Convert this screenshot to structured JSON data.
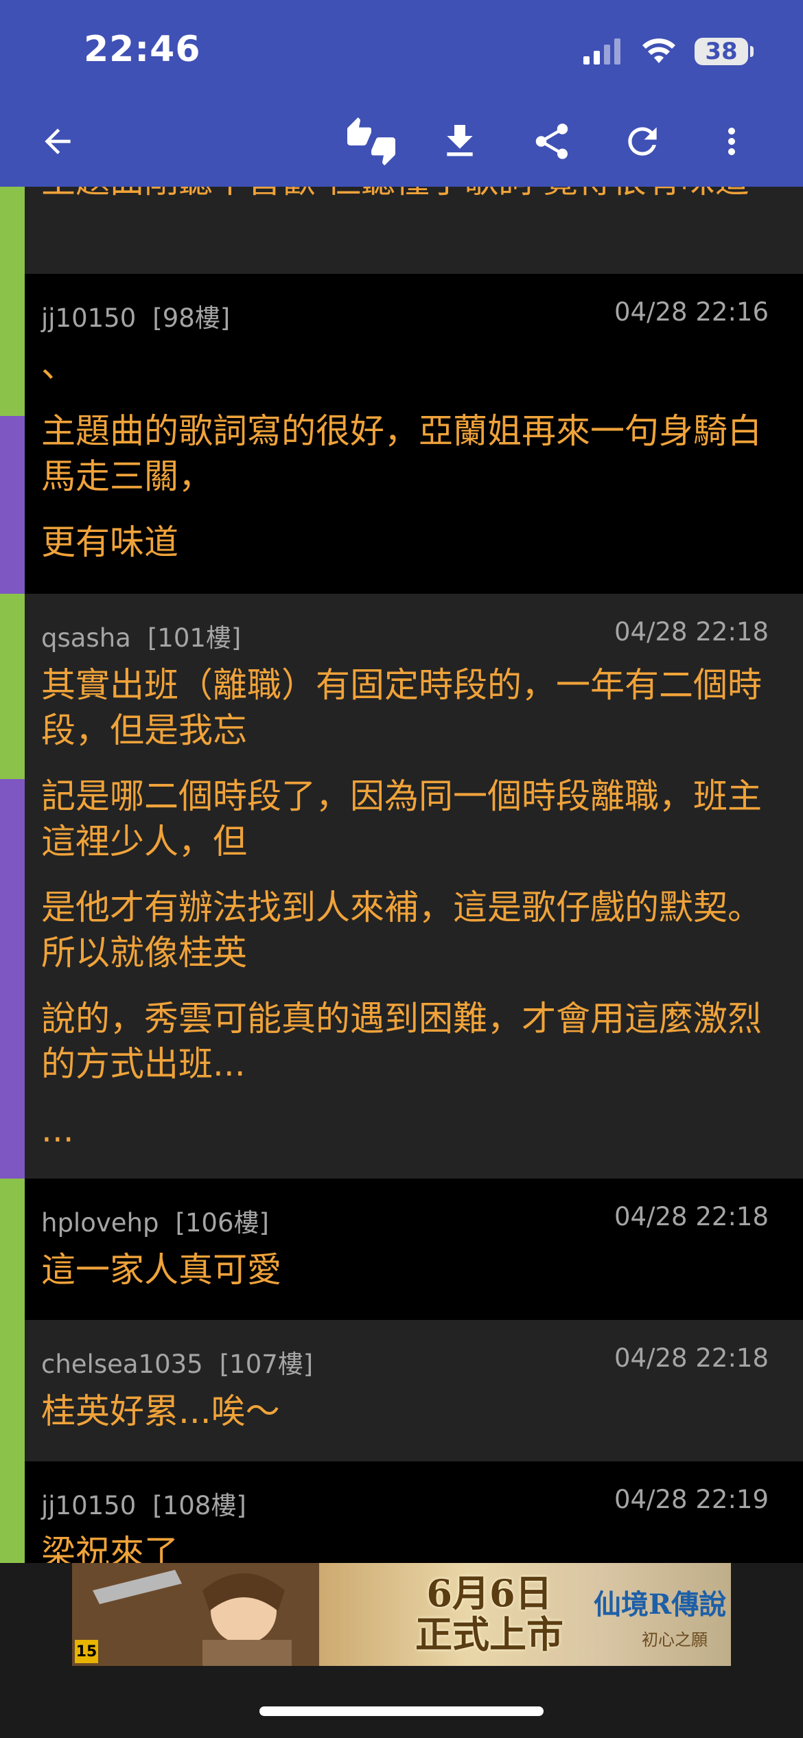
{
  "status_bar": {
    "time": "22:46",
    "battery": "38"
  },
  "toolbar": {
    "back_icon": "arrow-left-icon",
    "icons": [
      "thumbs-up-down-icon",
      "download-icon",
      "share-icon",
      "refresh-icon",
      "more-vert-icon"
    ]
  },
  "posts": [
    {
      "user": "",
      "floor": "",
      "time": "",
      "paragraphs": [
        "主題曲剛聽不喜歡 但聽懂了歌詞 覺得很有味道"
      ]
    },
    {
      "user": "jj10150",
      "floor": "[98樓]",
      "time": "04/28 22:16",
      "paragraphs": [
        "、",
        "主題曲的歌詞寫的很好，亞蘭姐再來一句身騎白馬走三關，",
        "更有味道"
      ]
    },
    {
      "user": "qsasha",
      "floor": "[101樓]",
      "time": "04/28 22:18",
      "paragraphs": [
        "其實出班（離職）有固定時段的，一年有二個時段，但是我忘",
        "記是哪二個時段了，因為同一個時段離職，班主這裡少人，但",
        "是他才有辦法找到人來補，這是歌仔戲的默契。所以就像桂英",
        "說的，秀雲可能真的遇到困難，才會用這麼激烈的方式出班...",
        "..."
      ]
    },
    {
      "user": "hplovehp",
      "floor": "[106樓]",
      "time": "04/28 22:18",
      "paragraphs": [
        "這一家人真可愛"
      ]
    },
    {
      "user": "chelsea1035",
      "floor": "[107樓]",
      "time": "04/28 22:18",
      "paragraphs": [
        "桂英好累...唉～"
      ]
    },
    {
      "user": "jj10150",
      "floor": "[108樓]",
      "time": "04/28 22:19",
      "paragraphs": [
        "梁祝來了"
      ]
    }
  ],
  "ad": {
    "title_line1": "6月6日",
    "title_line2": "正式上市",
    "logo": "仙境R傳說",
    "subtitle": "初心之願",
    "rating": "15"
  },
  "colors": {
    "appbar": "#3f51b5",
    "text_accent": "#f0a33a",
    "stripe_green": "#8bc34a",
    "stripe_purple": "#7e57c2"
  }
}
